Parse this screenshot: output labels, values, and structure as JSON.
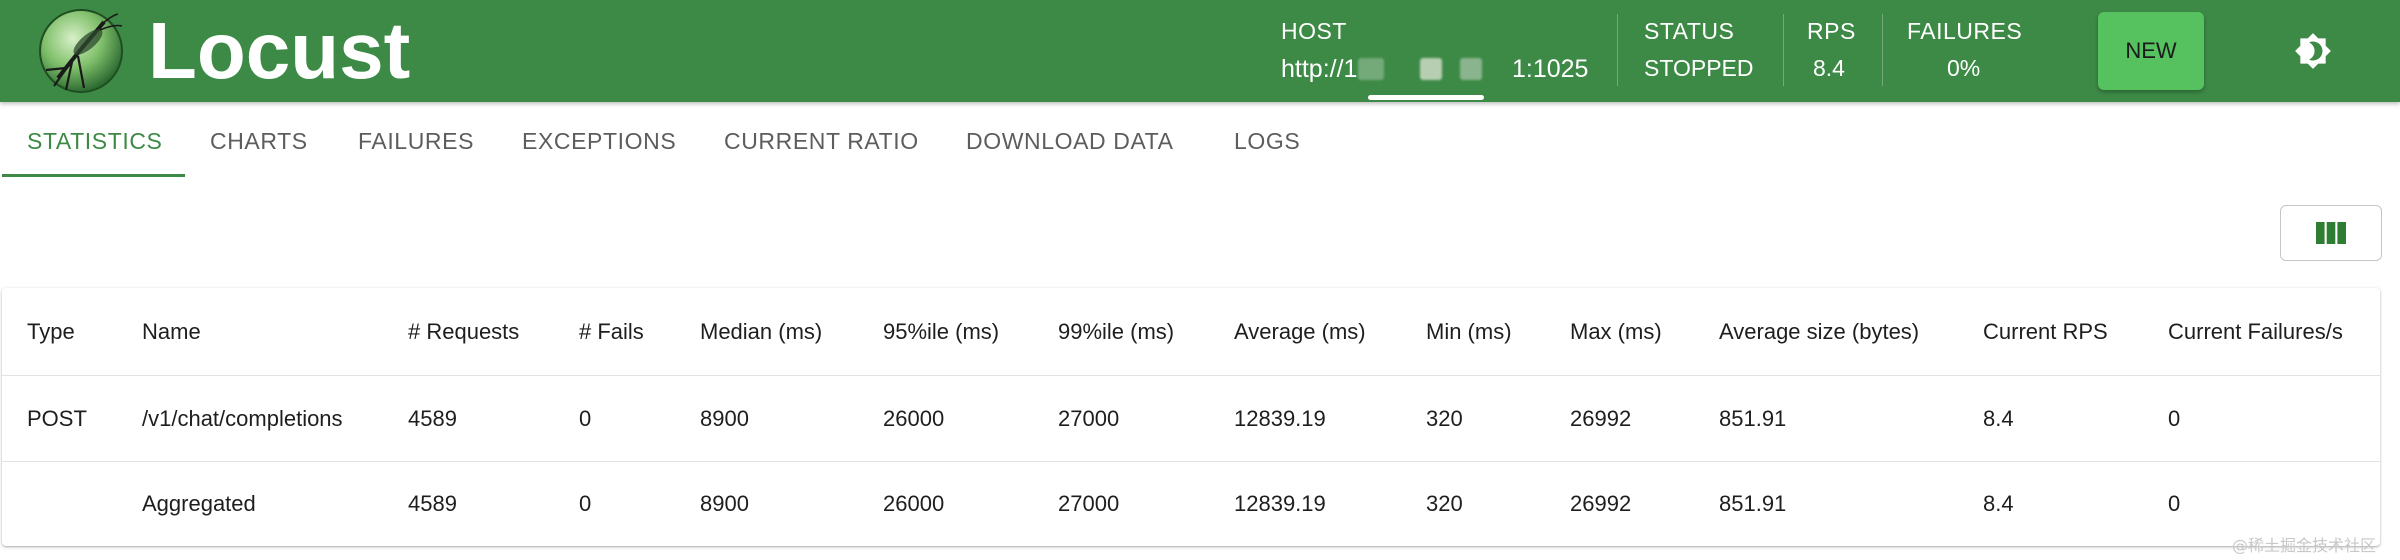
{
  "header": {
    "app_title": "Locust",
    "host": {
      "label": "HOST",
      "value_prefix": "http://1",
      "value_suffix": "1:1025"
    },
    "status": {
      "label": "STATUS",
      "value": "STOPPED"
    },
    "rps": {
      "label": "RPS",
      "value": "8.4"
    },
    "failures": {
      "label": "FAILURES",
      "value": "0%"
    },
    "new_button_label": "NEW",
    "theme_icon": "brightness-icon",
    "colors": {
      "header_bg": "#3d8a46",
      "new_button_bg": "#56c25f"
    }
  },
  "tabs": [
    {
      "label": "STATISTICS",
      "active": true
    },
    {
      "label": "CHARTS"
    },
    {
      "label": "FAILURES"
    },
    {
      "label": "EXCEPTIONS"
    },
    {
      "label": "CURRENT RATIO"
    },
    {
      "label": "DOWNLOAD DATA"
    },
    {
      "label": "LOGS"
    }
  ],
  "columns_button_icon": "view-columns-icon",
  "table": {
    "headers": [
      "Type",
      "Name",
      "# Requests",
      "# Fails",
      "Median (ms)",
      "95%ile (ms)",
      "99%ile (ms)",
      "Average (ms)",
      "Min (ms)",
      "Max (ms)",
      "Average size (bytes)",
      "Current RPS",
      "Current Failures/s"
    ],
    "rows": [
      [
        "POST",
        "/v1/chat/completions",
        "4589",
        "0",
        "8900",
        "26000",
        "27000",
        "12839.19",
        "320",
        "26992",
        "851.91",
        "8.4",
        "0"
      ],
      [
        "",
        "Aggregated",
        "4589",
        "0",
        "8900",
        "26000",
        "27000",
        "12839.19",
        "320",
        "26992",
        "851.91",
        "8.4",
        "0"
      ]
    ]
  },
  "watermark": "@稀土掘金技术社区"
}
